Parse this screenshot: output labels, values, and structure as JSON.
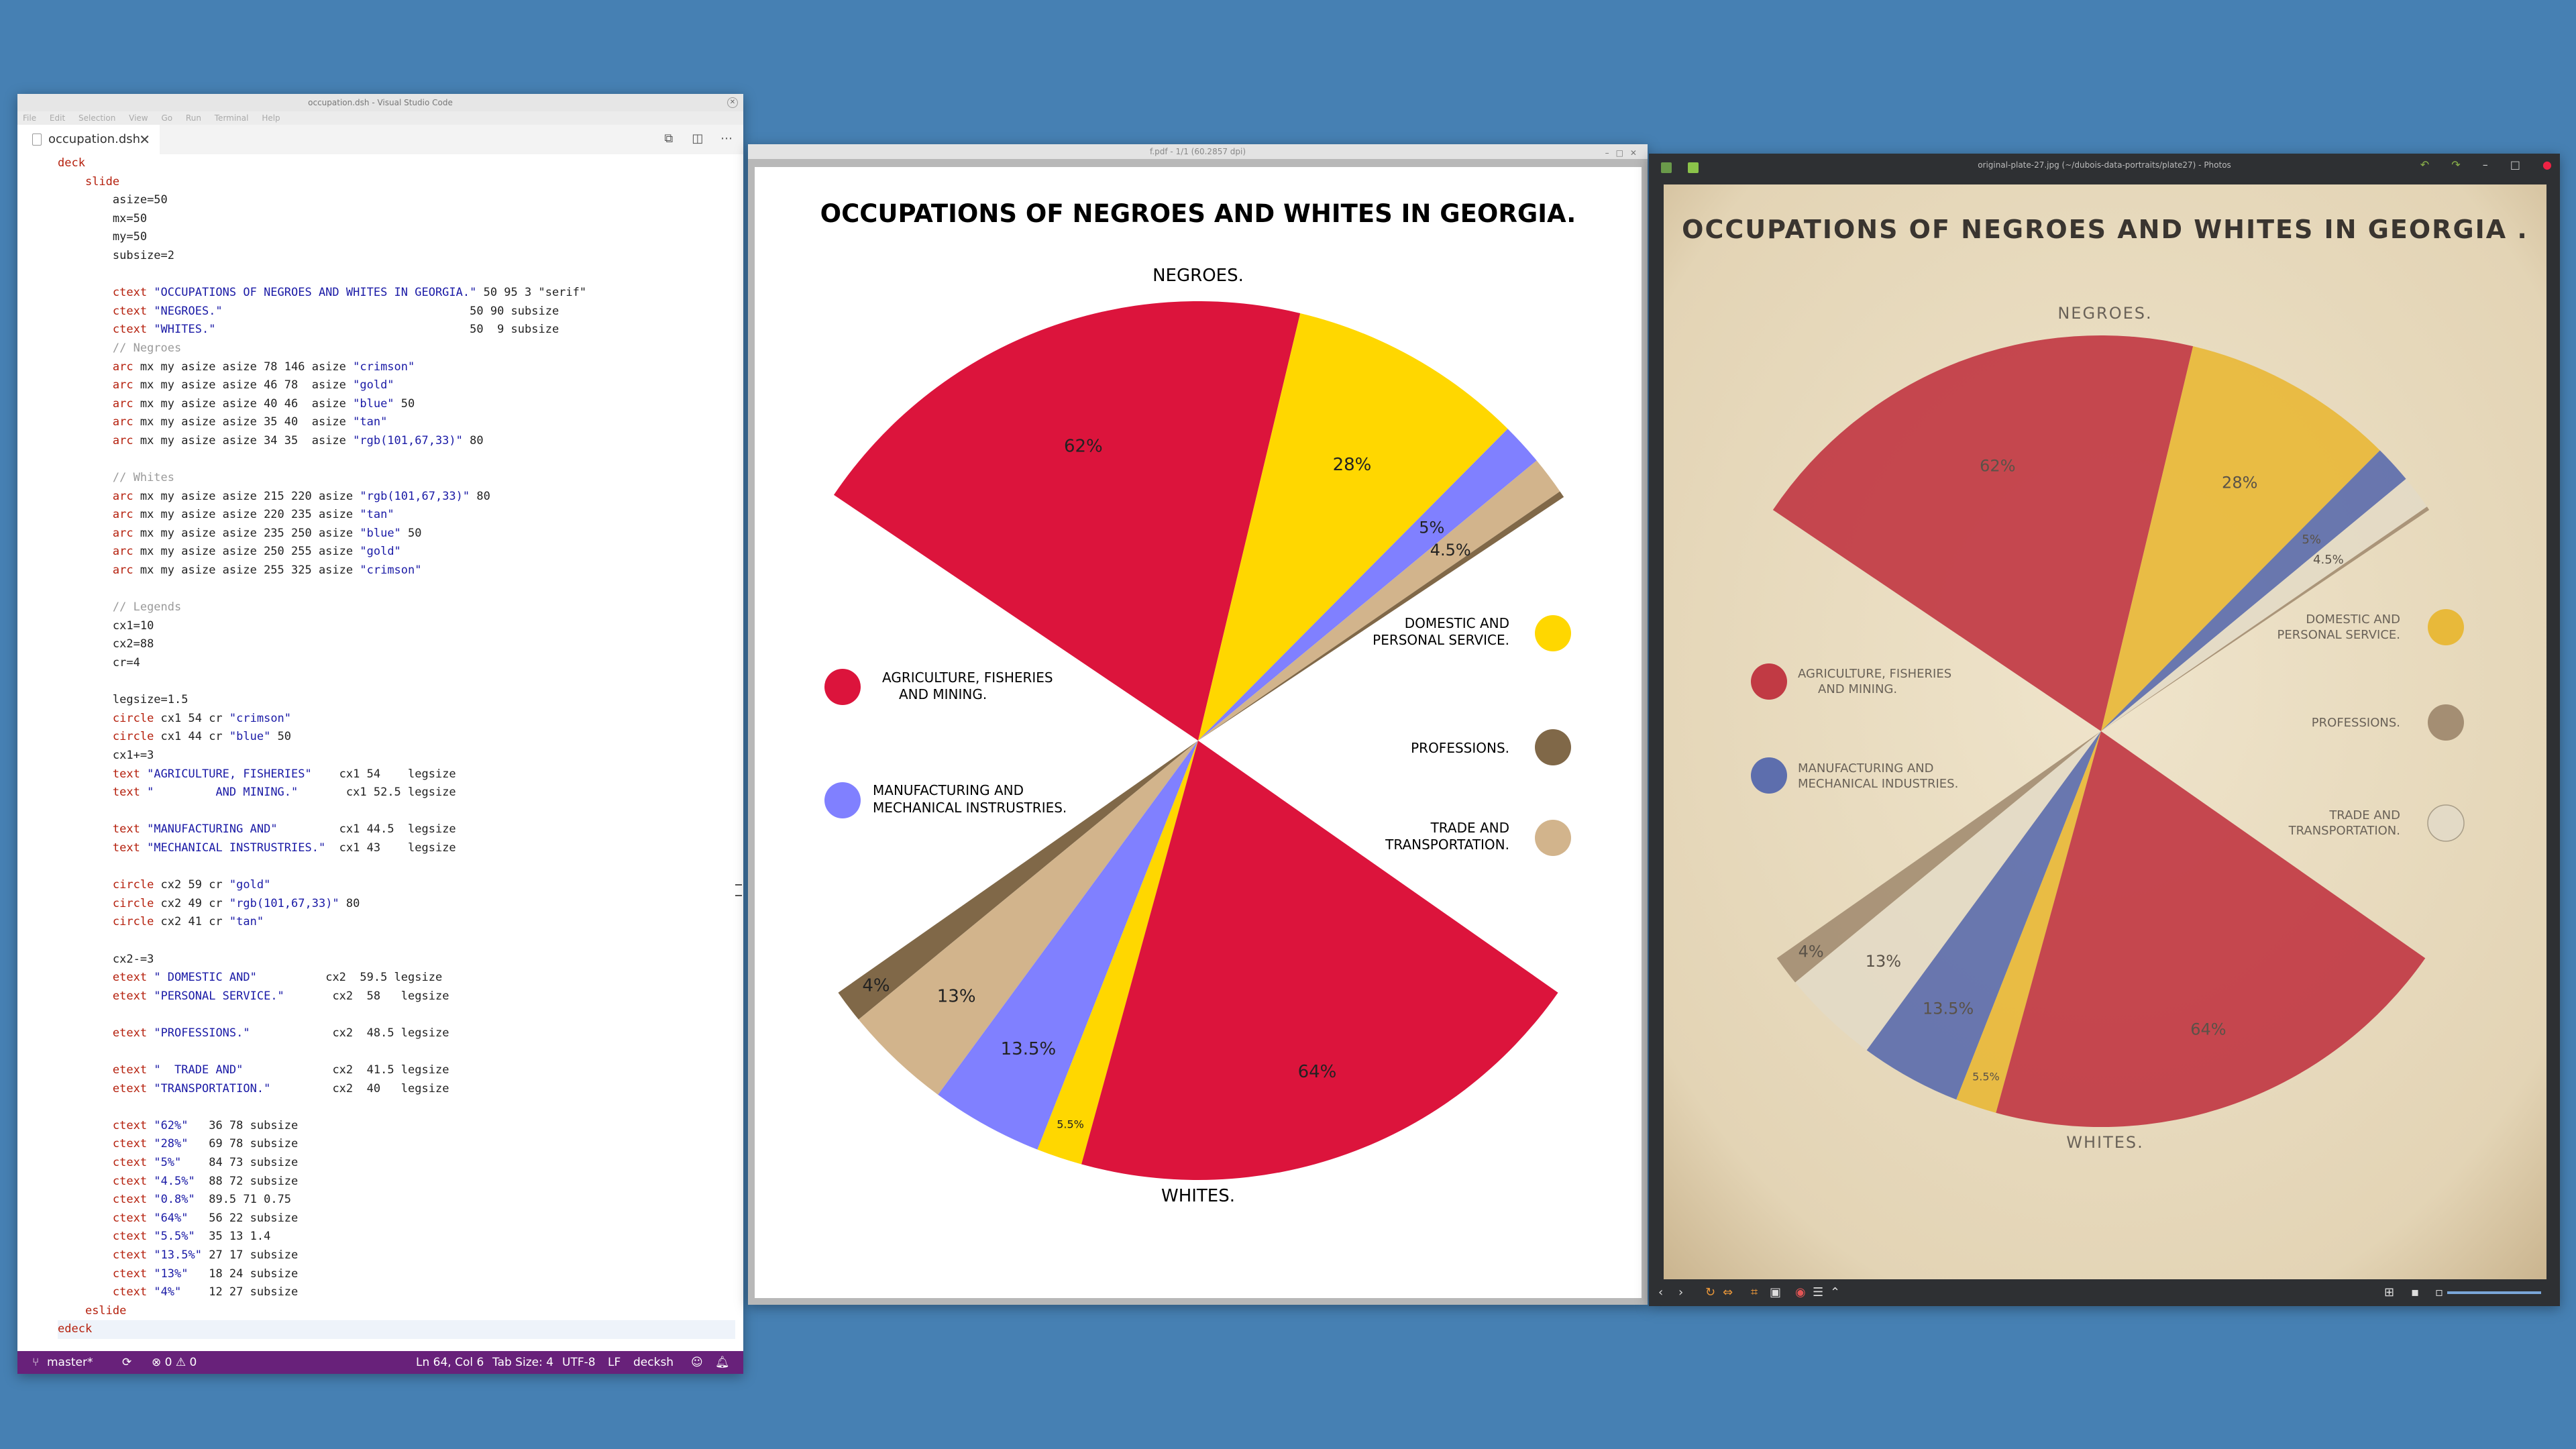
{
  "vscode": {
    "title": "occupation.dsh - Visual Studio Code",
    "menu": [
      "File",
      "Edit",
      "Selection",
      "View",
      "Go",
      "Run",
      "Terminal",
      "Help"
    ],
    "tab_label": "occupation.dsh",
    "code_lines": [
      {
        "indent": 0,
        "cls": "kw",
        "text": "deck"
      },
      {
        "indent": 1,
        "cls": "kw",
        "text": "slide"
      },
      {
        "indent": 2,
        "cls": "",
        "text": "asize=50"
      },
      {
        "indent": 2,
        "cls": "",
        "text": "mx=50"
      },
      {
        "indent": 2,
        "cls": "",
        "text": "my=50"
      },
      {
        "indent": 2,
        "cls": "",
        "text": "subsize=2"
      },
      {
        "indent": 0,
        "cls": "",
        "text": ""
      },
      {
        "indent": 2,
        "cls": "kwst",
        "kw": "ctext",
        "text": "\"OCCUPATIONS OF NEGROES AND WHITES IN GEORGIA.\"",
        "rest": " 50 95 3 \"serif\""
      },
      {
        "indent": 2,
        "cls": "kwst",
        "kw": "ctext",
        "text": "\"NEGROES.\"",
        "rest": "                                    50 90 subsize"
      },
      {
        "indent": 2,
        "cls": "kwst",
        "kw": "ctext",
        "text": "\"WHITES.\"",
        "rest": "                                     50  9 subsize"
      },
      {
        "indent": 2,
        "cls": "cm",
        "text": "// Negroes"
      },
      {
        "indent": 2,
        "cls": "arc",
        "kw": "arc",
        "text": " mx my asize asize 78 146 asize ",
        "str": "\"crimson\"",
        "rest": ""
      },
      {
        "indent": 2,
        "cls": "arc",
        "kw": "arc",
        "text": " mx my asize asize 46 78  asize ",
        "str": "\"gold\"",
        "rest": ""
      },
      {
        "indent": 2,
        "cls": "arc",
        "kw": "arc",
        "text": " mx my asize asize 40 46  asize ",
        "str": "\"blue\"",
        "rest": " 50"
      },
      {
        "indent": 2,
        "cls": "arc",
        "kw": "arc",
        "text": " mx my asize asize 35 40  asize ",
        "str": "\"tan\"",
        "rest": ""
      },
      {
        "indent": 2,
        "cls": "arc",
        "kw": "arc",
        "text": " mx my asize asize 34 35  asize ",
        "str": "\"rgb(101,67,33)\"",
        "rest": " 80"
      },
      {
        "indent": 0,
        "cls": "",
        "text": ""
      },
      {
        "indent": 2,
        "cls": "cm",
        "text": "// Whites"
      },
      {
        "indent": 2,
        "cls": "arc",
        "kw": "arc",
        "text": " mx my asize asize 215 220 asize ",
        "str": "\"rgb(101,67,33)\"",
        "rest": " 80"
      },
      {
        "indent": 2,
        "cls": "arc",
        "kw": "arc",
        "text": " mx my asize asize 220 235 asize ",
        "str": "\"tan\"",
        "rest": ""
      },
      {
        "indent": 2,
        "cls": "arc",
        "kw": "arc",
        "text": " mx my asize asize 235 250 asize ",
        "str": "\"blue\"",
        "rest": " 50"
      },
      {
        "indent": 2,
        "cls": "arc",
        "kw": "arc",
        "text": " mx my asize asize 250 255 asize ",
        "str": "\"gold\"",
        "rest": ""
      },
      {
        "indent": 2,
        "cls": "arc",
        "kw": "arc",
        "text": " mx my asize asize 255 325 asize ",
        "str": "\"crimson\"",
        "rest": ""
      },
      {
        "indent": 0,
        "cls": "",
        "text": ""
      },
      {
        "indent": 2,
        "cls": "cm",
        "text": "// Legends"
      },
      {
        "indent": 2,
        "cls": "",
        "text": "cx1=10"
      },
      {
        "indent": 2,
        "cls": "",
        "text": "cx2=88"
      },
      {
        "indent": 2,
        "cls": "",
        "text": "cr=4"
      },
      {
        "indent": 0,
        "cls": "",
        "text": ""
      },
      {
        "indent": 2,
        "cls": "",
        "text": "legsize=1.5"
      },
      {
        "indent": 2,
        "cls": "arc",
        "kw": "circle",
        "text": " cx1 54 cr ",
        "str": "\"crimson\"",
        "rest": ""
      },
      {
        "indent": 2,
        "cls": "arc",
        "kw": "circle",
        "text": " cx1 44 cr ",
        "str": "\"blue\"",
        "rest": " 50"
      },
      {
        "indent": 2,
        "cls": "",
        "text": "cx1+=3"
      },
      {
        "indent": 2,
        "cls": "arc",
        "kw": "text",
        "text": " ",
        "str": "\"AGRICULTURE, FISHERIES\"",
        "rest": "    cx1 54    legsize"
      },
      {
        "indent": 2,
        "cls": "arc",
        "kw": "text",
        "text": " ",
        "str": "\"         AND MINING.\"",
        "rest": "       cx1 52.5 legsize"
      },
      {
        "indent": 0,
        "cls": "",
        "text": ""
      },
      {
        "indent": 2,
        "cls": "arc",
        "kw": "text",
        "text": " ",
        "str": "\"MANUFACTURING AND\"",
        "rest": "         cx1 44.5  legsize"
      },
      {
        "indent": 2,
        "cls": "arc",
        "kw": "text",
        "text": " ",
        "str": "\"MECHANICAL INSTRUSTRIES.\"",
        "rest": "  cx1 43    legsize"
      },
      {
        "indent": 0,
        "cls": "",
        "text": ""
      },
      {
        "indent": 2,
        "cls": "arc",
        "kw": "circle",
        "text": " cx2 59 cr ",
        "str": "\"gold\"",
        "rest": ""
      },
      {
        "indent": 2,
        "cls": "arc",
        "kw": "circle",
        "text": " cx2 49 cr ",
        "str": "\"rgb(101,67,33)\"",
        "rest": " 80"
      },
      {
        "indent": 2,
        "cls": "arc",
        "kw": "circle",
        "text": " cx2 41 cr ",
        "str": "\"tan\"",
        "rest": ""
      },
      {
        "indent": 0,
        "cls": "",
        "text": ""
      },
      {
        "indent": 2,
        "cls": "",
        "text": "cx2-=3"
      },
      {
        "indent": 2,
        "cls": "arc",
        "kw": "etext",
        "text": " ",
        "str": "\" DOMESTIC AND\"",
        "rest": "          cx2  59.5 legsize"
      },
      {
        "indent": 2,
        "cls": "arc",
        "kw": "etext",
        "text": " ",
        "str": "\"PERSONAL SERVICE.\"",
        "rest": "       cx2  58   legsize"
      },
      {
        "indent": 0,
        "cls": "",
        "text": ""
      },
      {
        "indent": 2,
        "cls": "arc",
        "kw": "etext",
        "text": " ",
        "str": "\"PROFESSIONS.\"",
        "rest": "            cx2  48.5 legsize"
      },
      {
        "indent": 0,
        "cls": "",
        "text": ""
      },
      {
        "indent": 2,
        "cls": "arc",
        "kw": "etext",
        "text": " ",
        "str": "\"  TRADE AND\"",
        "rest": "             cx2  41.5 legsize"
      },
      {
        "indent": 2,
        "cls": "arc",
        "kw": "etext",
        "text": " ",
        "str": "\"TRANSPORTATION.\"",
        "rest": "         cx2  40   legsize"
      },
      {
        "indent": 0,
        "cls": "",
        "text": ""
      },
      {
        "indent": 2,
        "cls": "arc",
        "kw": "ctext",
        "text": " ",
        "str": "\"62%\"",
        "rest": "   36 78 subsize"
      },
      {
        "indent": 2,
        "cls": "arc",
        "kw": "ctext",
        "text": " ",
        "str": "\"28%\"",
        "rest": "   69 78 subsize"
      },
      {
        "indent": 2,
        "cls": "arc",
        "kw": "ctext",
        "text": " ",
        "str": "\"5%\"",
        "rest": "    84 73 subsize"
      },
      {
        "indent": 2,
        "cls": "arc",
        "kw": "ctext",
        "text": " ",
        "str": "\"4.5%\"",
        "rest": "  88 72 subsize"
      },
      {
        "indent": 2,
        "cls": "arc",
        "kw": "ctext",
        "text": " ",
        "str": "\"0.8%\"",
        "rest": "  89.5 71 0.75"
      },
      {
        "indent": 2,
        "cls": "arc",
        "kw": "ctext",
        "text": " ",
        "str": "\"64%\"",
        "rest": "   56 22 subsize"
      },
      {
        "indent": 2,
        "cls": "arc",
        "kw": "ctext",
        "text": " ",
        "str": "\"5.5%\"",
        "rest": "  35 13 1.4"
      },
      {
        "indent": 2,
        "cls": "arc",
        "kw": "ctext",
        "text": " ",
        "str": "\"13.5%\"",
        "rest": " 27 17 subsize"
      },
      {
        "indent": 2,
        "cls": "arc",
        "kw": "ctext",
        "text": " ",
        "str": "\"13%\"",
        "rest": "   18 24 subsize"
      },
      {
        "indent": 2,
        "cls": "arc",
        "kw": "ctext",
        "text": " ",
        "str": "\"4%\"",
        "rest": "    12 27 subsize"
      },
      {
        "indent": 1,
        "cls": "kw",
        "text": "eslide"
      },
      {
        "indent": 0,
        "cls": "kw",
        "text": "edeck"
      }
    ],
    "status": {
      "branch": "master*",
      "problems": "⊗ 0 ⚠ 0",
      "position": "Ln 64, Col 6",
      "tabsize": "Tab Size: 4",
      "encoding": "UTF-8",
      "eol": "LF",
      "language": "decksh"
    }
  },
  "pdf": {
    "title": "f.pdf - 1/1 (60.2857 dpi)",
    "chart_title": "OCCUPATIONS OF NEGROES AND WHITES IN GEORGIA.",
    "top_label": "NEGROES.",
    "bottom_label": "WHITES.",
    "legend_left": [
      {
        "line1": "AGRICULTURE, FISHERIES",
        "line2": "AND MINING.",
        "color": "#dc143c"
      },
      {
        "line1": "MANUFACTURING AND",
        "line2": "MECHANICAL INSTRUSTRIES.",
        "color": "#8080ff"
      }
    ],
    "legend_right": [
      {
        "line1": "DOMESTIC AND",
        "line2": "PERSONAL SERVICE.",
        "color": "#ffd700"
      },
      {
        "line1": "PROFESSIONS.",
        "line2": "",
        "color": "#806848"
      },
      {
        "line1": "TRADE AND",
        "line2": "TRANSPORTATION.",
        "color": "#d2b48c"
      }
    ]
  },
  "photos": {
    "title": "original-plate-27.jpg (~/dubois-data-portraits/plate27) - Photos",
    "chart_title": "OCCUPATIONS OF NEGROES AND WHITES IN GEORGIA .",
    "top_label": "NEGROES.",
    "bottom_label": "WHITES.",
    "legend_left": [
      {
        "line1": "AGRICULTURE, FISHERIES",
        "line2": "AND MINING.",
        "color": "#c13a44"
      },
      {
        "line1": "MANUFACTURING AND",
        "line2": "MECHANICAL INDUSTRIES.",
        "color": "#5d6ead"
      }
    ],
    "legend_right": [
      {
        "line1": "DOMESTIC AND",
        "line2": "PERSONAL SERVICE.",
        "color": "#e8b93a"
      },
      {
        "line1": "PROFESSIONS.",
        "line2": "",
        "color": "#a48e73"
      },
      {
        "line1": "TRADE AND",
        "line2": "TRANSPORTATION.",
        "color": "#e3dac6"
      }
    ]
  },
  "chart_data": [
    {
      "type": "pie",
      "title": "OCCUPATIONS OF NEGROES AND WHITES IN GEORGIA.",
      "series": [
        {
          "name": "NEGROES.",
          "slices": [
            {
              "category": "AGRICULTURE, FISHERIES AND MINING.",
              "value": 62,
              "label": "62%",
              "color": "#dc143c"
            },
            {
              "category": "DOMESTIC AND PERSONAL SERVICE.",
              "value": 28,
              "label": "28%",
              "color": "#ffd700"
            },
            {
              "category": "MANUFACTURING AND MECHANICAL INSTRUSTRIES.",
              "value": 5,
              "label": "5%",
              "color": "#8080ff"
            },
            {
              "category": "TRADE AND TRANSPORTATION.",
              "value": 4.5,
              "label": "4.5%",
              "color": "#d2b48c"
            },
            {
              "category": "PROFESSIONS.",
              "value": 0.8,
              "label": "",
              "color": "#806848"
            }
          ]
        },
        {
          "name": "WHITES.",
          "slices": [
            {
              "category": "AGRICULTURE, FISHERIES AND MINING.",
              "value": 64,
              "label": "64%",
              "color": "#dc143c"
            },
            {
              "category": "DOMESTIC AND PERSONAL SERVICE.",
              "value": 5.5,
              "label": "5.5%",
              "color": "#ffd700"
            },
            {
              "category": "MANUFACTURING AND MECHANICAL INSTRUSTRIES.",
              "value": 13.5,
              "label": "13.5%",
              "color": "#8080ff"
            },
            {
              "category": "TRADE AND TRANSPORTATION.",
              "value": 13,
              "label": "13%",
              "color": "#d2b48c"
            },
            {
              "category": "PROFESSIONS.",
              "value": 4,
              "label": "4%",
              "color": "#806848"
            }
          ]
        }
      ]
    },
    {
      "type": "pie",
      "title": "OCCUPATIONS OF NEGROES AND WHITES IN GEORGIA .",
      "series": [
        {
          "name": "NEGROES.",
          "slices": [
            {
              "category": "AGRICULTURE, FISHERIES AND MINING.",
              "value": 62,
              "label": "62%",
              "color": "#c13a44"
            },
            {
              "category": "DOMESTIC AND PERSONAL SERVICE.",
              "value": 28,
              "label": "28%",
              "color": "#e8b93a"
            },
            {
              "category": "MANUFACTURING AND MECHANICAL INDUSTRIES.",
              "value": 5,
              "label": "5%",
              "color": "#5d6ead"
            },
            {
              "category": "TRADE AND TRANSPORTATION.",
              "value": 4.5,
              "label": "4.5%",
              "color": "#e3dac6"
            },
            {
              "category": "PROFESSIONS.",
              "value": 0.5,
              "label": "",
              "color": "#a48e73"
            }
          ]
        },
        {
          "name": "WHITES.",
          "slices": [
            {
              "category": "AGRICULTURE, FISHERIES AND MINING.",
              "value": 64,
              "label": "64%",
              "color": "#c13a44"
            },
            {
              "category": "DOMESTIC AND PERSONAL SERVICE.",
              "value": 5.5,
              "label": "5.5%",
              "color": "#e8b93a"
            },
            {
              "category": "MANUFACTURING AND MECHANICAL INDUSTRIES.",
              "value": 13.5,
              "label": "13.5%",
              "color": "#5d6ead"
            },
            {
              "category": "TRADE AND TRANSPORTATION.",
              "value": 13,
              "label": "13%",
              "color": "#e3dac6"
            },
            {
              "category": "PROFESSIONS.",
              "value": 4,
              "label": "4%",
              "color": "#a48e73"
            }
          ]
        }
      ]
    }
  ]
}
